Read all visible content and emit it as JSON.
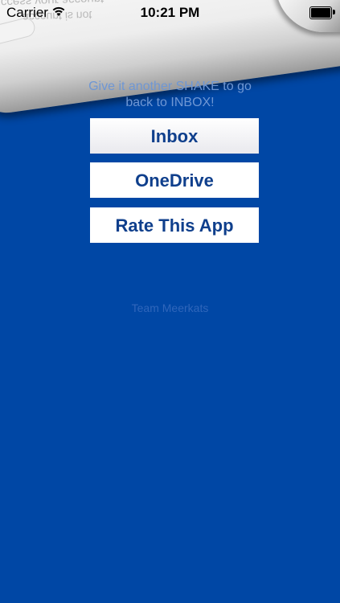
{
  "status_bar": {
    "carrier": "Carrier",
    "time": "10:21 PM",
    "wifi_icon": "wifi-icon",
    "battery_icon": "battery-full-icon"
  },
  "curl": {
    "mirrored_text_1": "success your account",
    "mirrored_text_2": "account is not"
  },
  "hint": {
    "line1": "Give it another SHAKE to go",
    "line2": "back to INBOX!"
  },
  "buttons": {
    "inbox": "Inbox",
    "onedrive": "OneDrive",
    "rate": "Rate This App"
  },
  "footer": {
    "team": "Team Meerkats"
  },
  "colors": {
    "background": "#0047a5",
    "button_text": "#0f3f8c",
    "hint_text": "#6f97d4"
  }
}
